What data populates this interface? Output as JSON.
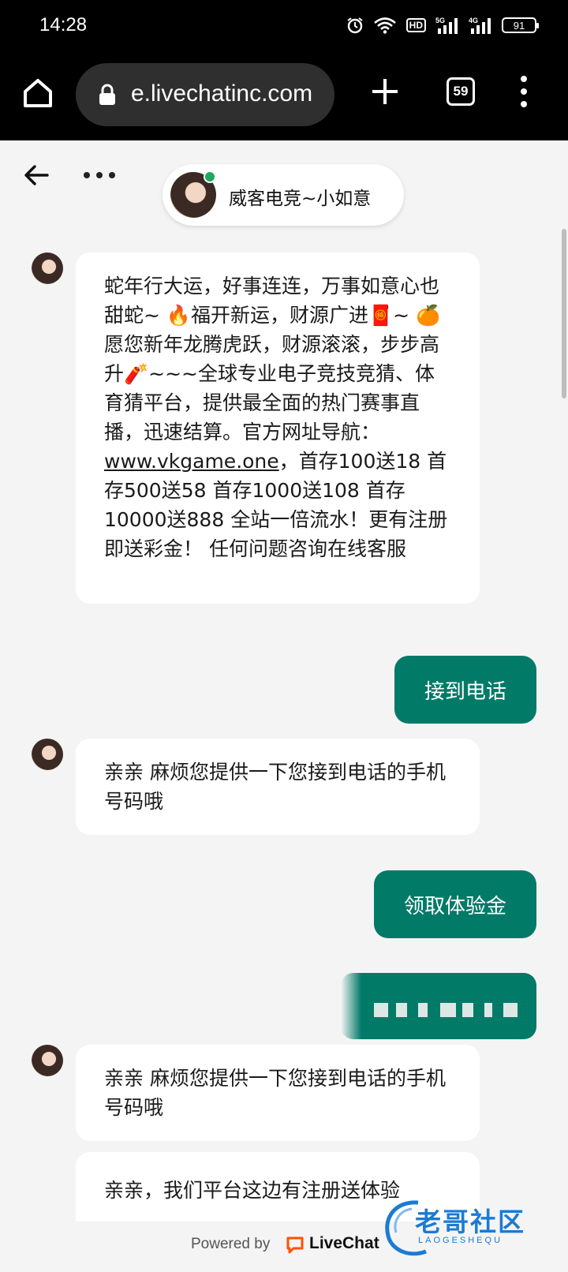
{
  "status_bar": {
    "time": "14:28",
    "network_badge": "HD",
    "signal_1": "5G",
    "signal_2": "4G",
    "battery": "91"
  },
  "browser": {
    "url": "e.livechatinc.com",
    "tab_count": "59",
    "icons": [
      "home-icon",
      "lock-icon",
      "plus-icon",
      "tabs-icon",
      "more-vert-icon"
    ]
  },
  "chat": {
    "agent_name": "威客电竞~小如意",
    "agent_online_color": "#1fa85f",
    "accent_color": "#027a68",
    "messages": [
      {
        "from": "agent",
        "text_before_link": "蛇年行大运，好事连连，万事如意心也甜蛇~ 🔥福开新运，财源广进🧧~ 🍊愿您新年龙腾虎跃，财源滚滚，步步高升🧨~~~全球专业电子竞技竞猜、体育猜平台，提供最全面的热门赛事直播，迅速结算。官方网址导航：",
        "link": "www.vkgame.one",
        "text_after_link": "，首存100送18 首存500送58 首存1000送108 首存10000送888 全站一倍流水！更有注册即送彩金！ 任何问题咨询在线客服"
      },
      {
        "from": "visitor",
        "text": "接到电话"
      },
      {
        "from": "agent",
        "text": "亲亲 麻烦您提供一下您接到电话的手机号码哦"
      },
      {
        "from": "visitor",
        "text": "领取体验金"
      },
      {
        "from": "visitor",
        "text": ""
      },
      {
        "from": "agent",
        "text": "亲亲 麻烦您提供一下您接到电话的手机号码哦"
      },
      {
        "from": "agent",
        "text": "亲亲，我们平台这边有注册送体验"
      }
    ]
  },
  "footer": {
    "powered_by": "Powered by",
    "brand": "LiveChat",
    "brand_color": "#ff5100"
  },
  "watermark": {
    "text": "老哥社区",
    "sub": "LAOGESHEQU",
    "color": "#1b7bd3"
  }
}
